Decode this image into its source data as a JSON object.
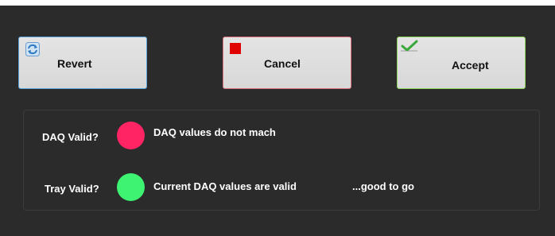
{
  "buttons": {
    "revert": {
      "label": "Revert",
      "icon": "refresh-icon"
    },
    "cancel": {
      "label": "Cancel",
      "icon": "red-square-icon"
    },
    "accept": {
      "label": "Accept",
      "icon": "checkmark-icon"
    }
  },
  "status": {
    "daq": {
      "label": "DAQ Valid?",
      "indicator_color": "#ff2464",
      "message": "DAQ values do not mach"
    },
    "tray": {
      "label": "Tray Valid?",
      "indicator_color": "#3ef272",
      "message": "Current DAQ values are valid",
      "note": "...good to go"
    }
  },
  "colors": {
    "background": "#2b2b2b",
    "revert_border": "#58a6dc",
    "cancel_border": "#d9707c",
    "accept_border": "#8dd85a"
  }
}
